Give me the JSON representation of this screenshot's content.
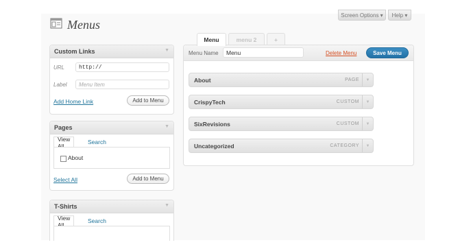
{
  "header": {
    "title": "Menus",
    "screen_options_label": "Screen Options ▾",
    "help_label": "Help ▾"
  },
  "custom_links": {
    "title": "Custom Links",
    "url_label": "URL",
    "url_value": "http://",
    "label_label": "Label",
    "label_placeholder": "Menu Item",
    "add_home_link": "Add Home Link",
    "add_button": "Add to Menu"
  },
  "pages": {
    "title": "Pages",
    "tabs": [
      "View All",
      "Search"
    ],
    "items": [
      {
        "label": "About",
        "checked": false
      }
    ],
    "select_all": "Select All",
    "add_button": "Add to Menu"
  },
  "tshirts": {
    "title": "T-Shirts",
    "tabs": [
      "View All",
      "Search"
    ]
  },
  "menu_tabs": [
    {
      "label": "Menu",
      "active": true
    },
    {
      "label": "menu 2",
      "active": false
    },
    {
      "label": "+",
      "active": false
    }
  ],
  "editor": {
    "menu_name_label": "Menu Name",
    "menu_name_value": "Menu",
    "delete_label": "Delete Menu",
    "save_label": "Save Menu",
    "items": [
      {
        "title": "About",
        "type": "PAGE"
      },
      {
        "title": "CrispyTech",
        "type": "CUSTOM"
      },
      {
        "title": "SixRevisions",
        "type": "CUSTOM"
      },
      {
        "title": "Uncategorized",
        "type": "CATEGORY"
      }
    ]
  },
  "colors": {
    "link": "#21759b",
    "save_button": "#2e7fb3",
    "delete_link": "#d54e21"
  }
}
